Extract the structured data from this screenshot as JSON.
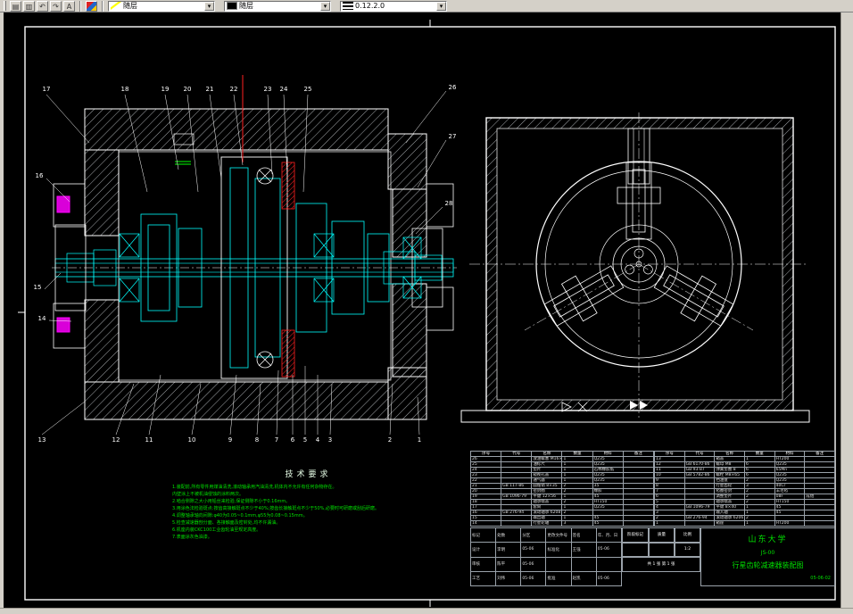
{
  "toolbar": {
    "color_value": "随层",
    "linetype_value": "随层",
    "lineweight_value": "0.12.2.0"
  },
  "balloons": {
    "top": [
      "17",
      "18",
      "19",
      "20",
      "21",
      "22",
      "23",
      "24",
      "25"
    ],
    "right": [
      "26",
      "27",
      "28"
    ],
    "left": [
      "16",
      "15",
      "14"
    ],
    "bottom": [
      "13",
      "12",
      "11",
      "10",
      "9",
      "8",
      "7",
      "6",
      "5",
      "4",
      "3",
      "2",
      "1"
    ]
  },
  "techreq": {
    "title": "技术要求",
    "lines": [
      "1.装配前,所有零件用煤油清洗,滚动轴承用汽油清洗,机体内不允许有任何杂物存在。",
      "内壁涂上不被机油侵蚀的涂料两次。",
      "2.啮合侧隙之大小用铅丝来检验,保证侧隙不小于0.16mm。",
      "3.用涂色法检验斑点:按齿高接触斑点不少于40%;按齿长接触斑点不少于50%,必要时可研磨或刮后研磨。",
      "4.调整轴承轴向间隙:φ40为0.05~0.1mm,φ55为0.08~0.15mm。",
      "5.检查减速器剖分面、各接触面及密封处,均不许漏油。",
      "6.机座内装CKC100工业齿轮油至规定高度。",
      "7.表面涂灰色油漆。"
    ]
  },
  "bom": {
    "left": [
      [
        "序号",
        "代号",
        "名称",
        "数量",
        "材料",
        "备注"
      ],
      [
        "26",
        "",
        "放油螺塞 M16×1.5",
        "1",
        "Q235",
        ""
      ],
      [
        "25",
        "",
        "油标尺",
        "1",
        "Q235",
        ""
      ],
      [
        "24",
        "",
        "垫片",
        "1",
        "石棉橡胶纸",
        ""
      ],
      [
        "23",
        "",
        "窥视孔盖",
        "1",
        "Q235",
        ""
      ],
      [
        "22",
        "",
        "通气器",
        "1",
        "Q235",
        ""
      ],
      [
        "21",
        "GB 117-86",
        "圆锥销 8×35",
        "2",
        "35",
        ""
      ],
      [
        "20",
        "",
        "密封圈",
        "2",
        "橡胶",
        ""
      ],
      [
        "19",
        "GB 1096-79",
        "平键 12×56",
        "1",
        "45",
        ""
      ],
      [
        "18",
        "",
        "轴承端盖",
        "2",
        "HT150",
        ""
      ],
      [
        "17",
        "",
        "套筒",
        "1",
        "Q235",
        ""
      ],
      [
        "16",
        "GB 276-94",
        "滚动轴承 6208",
        "2",
        "",
        ""
      ],
      [
        "15",
        "",
        "输出轴",
        "1",
        "45",
        ""
      ],
      [
        "14",
        "",
        "行星轮轴",
        "3",
        "45",
        ""
      ]
    ],
    "right": [
      [
        "序号",
        "代号",
        "名称",
        "数量",
        "材料",
        "备注"
      ],
      [
        "13",
        "",
        "箱盖",
        "1",
        "HT200",
        ""
      ],
      [
        "12",
        "GB 6170-86",
        "螺母 M8",
        "6",
        "Q235",
        ""
      ],
      [
        "11",
        "GB 93-87",
        "弹簧垫圈 8",
        "6",
        "65Mn",
        ""
      ],
      [
        "10",
        "GB 5782-86",
        "螺栓 M8×65",
        "6",
        "Q235",
        ""
      ],
      [
        "9",
        "",
        "挡油盘",
        "2",
        "Q235",
        ""
      ],
      [
        "8",
        "",
        "行星齿轮",
        "3",
        "40Cr",
        ""
      ],
      [
        "7",
        "",
        "毡圈密封",
        "2",
        "羊毛毡",
        ""
      ],
      [
        "6",
        "",
        "调整垫片",
        "2",
        "08F",
        "成组"
      ],
      [
        "5",
        "",
        "轴承端盖",
        "2",
        "HT150",
        ""
      ],
      [
        "4",
        "GB 1096-79",
        "平键 8×40",
        "1",
        "45",
        ""
      ],
      [
        "3",
        "",
        "输入轴",
        "1",
        "45",
        ""
      ],
      [
        "2",
        "GB 276-94",
        "滚动轴承 6206",
        "2",
        "",
        ""
      ],
      [
        "1",
        "",
        "箱座",
        "1",
        "HT200",
        ""
      ]
    ]
  },
  "title_block": {
    "sig": [
      [
        "标记",
        "处数",
        "分区",
        "更改文件号",
        "签名",
        "年、月、日"
      ],
      [
        "设计",
        "李明",
        "05-06",
        "标准化",
        "王强",
        "05-06"
      ],
      [
        "审核",
        "陈平",
        "05-06",
        "",
        "",
        ""
      ],
      [
        "工艺",
        "刘伟",
        "05-06",
        "批准",
        "赵凯",
        "05-06"
      ]
    ],
    "mid": {
      "stage_label": "阶段标记",
      "mass_label": "质量",
      "scale_label": "比例",
      "mass": "",
      "scale": "1:2",
      "sheets": "共 1 张  第 1 张"
    },
    "school": {
      "name": "山东大学",
      "code": "JS-00",
      "title": "行星齿轮减速器装配图",
      "date": "05-06-02"
    }
  }
}
